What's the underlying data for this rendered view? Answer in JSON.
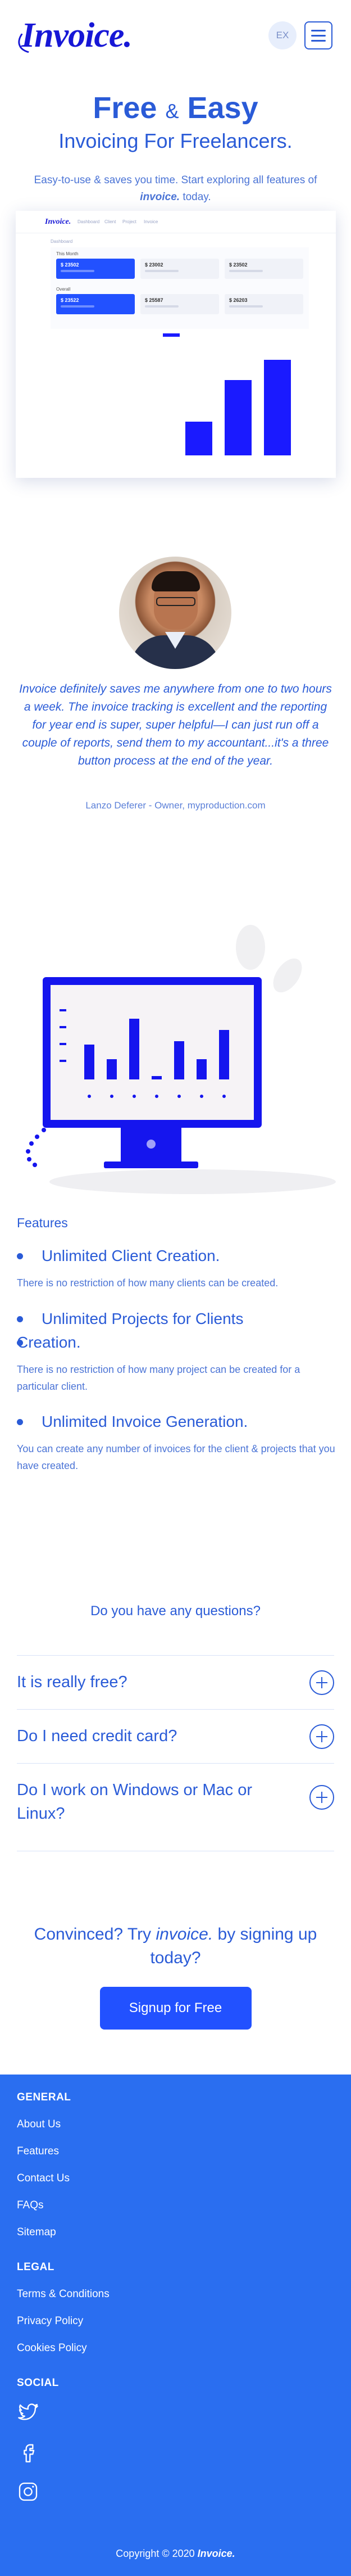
{
  "header": {
    "logo": "Invoice.",
    "lang": "EX"
  },
  "hero": {
    "title_a": "Free",
    "title_amp": "&",
    "title_b": "Easy",
    "subtitle": "Invoicing For Freelancers.",
    "desc_before": "Easy-to-use & saves you time. Start exploring all features of",
    "desc_brand": "invoice.",
    "desc_after": "today."
  },
  "dashboard_mock": {
    "logo": "Invoice.",
    "nav": [
      "Dashboard",
      "Client",
      "Project",
      "Invoice"
    ],
    "section_label": "Dashboard",
    "row1_label": "This Month",
    "row2_label": "Overall",
    "row1_cards": [
      "$ 23502",
      "$ 23002",
      "$ 23502"
    ],
    "row2_cards": [
      "$ 23522",
      "$ 25587",
      "$ 26203"
    ],
    "chart": {
      "type": "bar",
      "values": [
        0,
        0,
        0,
        0.3,
        0.67,
        0.85
      ]
    }
  },
  "testimonial": {
    "quote": "Invoice definitely saves me anywhere from one to two hours a week. The invoice tracking is excellent and the reporting for year end is super, super helpful—I can just run off a couple of reports, send them to my accountant...it's a three button process at the end of the year.",
    "author": "Lanzo Deferer - Owner, myproduction.com"
  },
  "features": {
    "heading": "Features",
    "items": [
      {
        "title": "Unlimited Client Creation.",
        "desc": "There is no restriction of how many clients can be created."
      },
      {
        "title": "Unlimited Projects for Clients",
        "title2": "Creation.",
        "desc": "There is no restriction of how many project can be created for a particular client."
      },
      {
        "title": "Unlimited Invoice Generation.",
        "desc": "You can create any number of invoices for the client & projects that you have created."
      }
    ]
  },
  "faq": {
    "heading": "Do you have any questions?",
    "items": [
      "It is really free?",
      "Do I need credit card?",
      "Do I work on Windows or Mac or Linux?"
    ]
  },
  "cta": {
    "text_before": "Convinced? Try",
    "text_brand": "invoice.",
    "text_after": "by signing up today?",
    "button": "Signup for Free"
  },
  "footer": {
    "general_heading": "GENERAL",
    "general_links": [
      "About Us",
      "Features",
      "Contact Us",
      "FAQs",
      "Sitemap"
    ],
    "legal_heading": "LEGAL",
    "legal_links": [
      "Terms & Conditions",
      "Privacy Policy",
      "Cookies Policy"
    ],
    "social_heading": "SOCIAL",
    "social_icons": [
      "twitter-icon",
      "facebook-icon",
      "instagram-icon"
    ],
    "copyright_before": "Copyright © 2020",
    "copyright_brand": "Invoice."
  },
  "colors": {
    "brand": "#2a5bd7",
    "logo": "#1717d6",
    "button": "#2251ff",
    "footer": "#2a6ef0"
  }
}
